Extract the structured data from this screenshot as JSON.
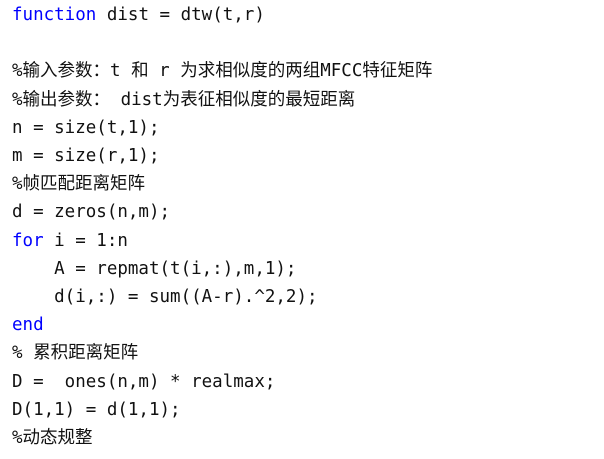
{
  "editor": {
    "lines": [
      {
        "segments": [
          {
            "text": "function",
            "type": "keyword"
          },
          {
            "text": " dist = dtw(t,r)",
            "type": "code"
          }
        ]
      },
      {
        "segments": []
      },
      {
        "segments": [
          {
            "text": "%输入参数：t 和 r 为求相似度的两组MFCC特征矩阵",
            "type": "comment"
          }
        ]
      },
      {
        "segments": [
          {
            "text": "%输出参数： dist为表征相似度的最短距离",
            "type": "comment"
          }
        ]
      },
      {
        "segments": [
          {
            "text": "n = size(t,1);",
            "type": "code"
          }
        ]
      },
      {
        "segments": [
          {
            "text": "m = size(r,1);",
            "type": "code"
          }
        ]
      },
      {
        "segments": [
          {
            "text": "%帧匹配距离矩阵",
            "type": "comment"
          }
        ]
      },
      {
        "segments": [
          {
            "text": "d = zeros(n,m);",
            "type": "code"
          }
        ]
      },
      {
        "segments": [
          {
            "text": "for",
            "type": "keyword"
          },
          {
            "text": " i = 1:n",
            "type": "code"
          }
        ]
      },
      {
        "segments": [
          {
            "text": "    A = repmat(t(i,:),m,1);",
            "type": "code"
          }
        ]
      },
      {
        "segments": [
          {
            "text": "    d(i,:) = sum((A-r).^2,2);",
            "type": "code"
          }
        ]
      },
      {
        "segments": [
          {
            "text": "end",
            "type": "keyword"
          }
        ]
      },
      {
        "segments": [
          {
            "text": "% 累积距离矩阵",
            "type": "comment"
          }
        ]
      },
      {
        "segments": [
          {
            "text": "D =  ones(n,m) * realmax;",
            "type": "code"
          }
        ]
      },
      {
        "segments": [
          {
            "text": "D(1,1) = d(1,1);",
            "type": "code"
          }
        ]
      },
      {
        "segments": [
          {
            "text": "%动态规整",
            "type": "comment"
          }
        ]
      }
    ]
  },
  "colors": {
    "keyword": "#0000ff",
    "code": "#111111",
    "comment": "#111111",
    "background": "#ffffff"
  }
}
